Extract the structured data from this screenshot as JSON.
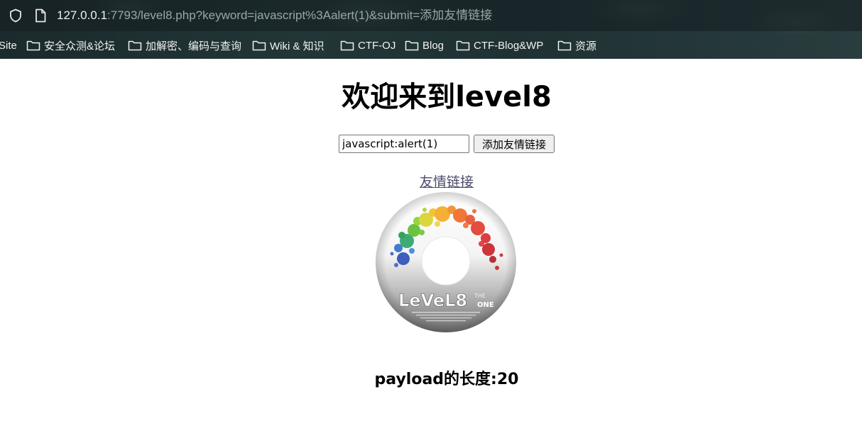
{
  "browser": {
    "url_host": "127.0.0.1",
    "url_rest": ":7793/level8.php?keyword=javascript%3Aalert(1)&submit=添加友情链接",
    "bookmarks": [
      {
        "label": "Site",
        "icon": "none"
      },
      {
        "label": "安全众测&论坛",
        "icon": "folder-icon"
      },
      {
        "label": "加解密、编码与查询",
        "icon": "folder-icon"
      },
      {
        "label": "Wiki & 知识",
        "icon": "folder-icon"
      },
      {
        "label": "CTF-OJ",
        "icon": "folder-icon"
      },
      {
        "label": "Blog",
        "icon": "folder-icon"
      },
      {
        "label": "CTF-Blog&WP",
        "icon": "folder-icon"
      },
      {
        "label": "资源",
        "icon": "folder-icon"
      }
    ]
  },
  "page": {
    "title": "欢迎来到level8",
    "form": {
      "keyword_value": "javascript:alert(1)",
      "submit_label": "添加友情链接"
    },
    "friend_link_label": "友情链接",
    "disc_image": {
      "logo_text": "LeVeL8",
      "small_text_top": "THE",
      "small_text_bottom": "ONE"
    },
    "payload_length_text": "payload的长度:20"
  },
  "colors": {
    "chrome_bg": "#223637",
    "link": "#4a4a6a",
    "button_bg": "#efefef"
  }
}
